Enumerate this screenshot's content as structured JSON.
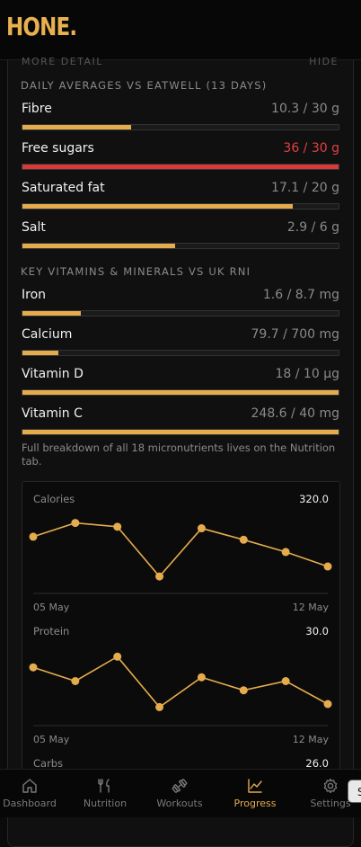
{
  "app": {
    "logo": "HONE."
  },
  "peek": {
    "left": "MORE DETAIL",
    "right": "HIDE"
  },
  "averages": {
    "title": "DAILY AVERAGES VS EATWELL (13 DAYS)",
    "items": [
      {
        "name": "Fibre",
        "value": "10.3 / 30 g",
        "fraction": 0.343,
        "over": false
      },
      {
        "name": "Free sugars",
        "value": "36 / 30 g",
        "fraction": 1.0,
        "over": true
      },
      {
        "name": "Saturated fat",
        "value": "17.1 / 20 g",
        "fraction": 0.855,
        "over": false
      },
      {
        "name": "Salt",
        "value": "2.9 / 6 g",
        "fraction": 0.483,
        "over": false
      }
    ]
  },
  "vitamins": {
    "title": "KEY VITAMINS & MINERALS VS UK RNI",
    "items": [
      {
        "name": "Iron",
        "value": "1.6 / 8.7 mg",
        "fraction": 0.184,
        "over": false
      },
      {
        "name": "Calcium",
        "value": "79.7 / 700 mg",
        "fraction": 0.114,
        "over": false
      },
      {
        "name": "Vitamin D",
        "value": "18 / 10 µg",
        "fraction": 1.0,
        "over": false
      },
      {
        "name": "Vitamin C",
        "value": "248.6 / 40 mg",
        "fraction": 1.0,
        "over": false
      }
    ]
  },
  "note": "Full breakdown of all 18 micronutrients lives on the Nutrition tab.",
  "trends": [
    {
      "label": "Calories",
      "max": "320.0",
      "start": "05 May",
      "end": "12 May",
      "normalized": [
        0.66,
        0.84,
        0.79,
        0.14,
        0.77,
        0.62,
        0.46,
        0.27
      ]
    },
    {
      "label": "Protein",
      "max": "30.0",
      "start": "05 May",
      "end": "12 May",
      "normalized": [
        0.68,
        0.5,
        0.82,
        0.16,
        0.55,
        0.38,
        0.5,
        0.2
      ]
    },
    {
      "label": "Carbs",
      "max": "26.0"
    }
  ],
  "nav": [
    {
      "label": "Dashboard",
      "icon": "home-icon",
      "active": false
    },
    {
      "label": "Nutrition",
      "icon": "fork-knife-icon",
      "active": false
    },
    {
      "label": "Workouts",
      "icon": "dumbbell-icon",
      "active": false
    },
    {
      "label": "Progress",
      "icon": "chart-icon",
      "active": true
    },
    {
      "label": "Settings",
      "icon": "gear-icon",
      "active": false
    }
  ],
  "toast": {
    "text": "S"
  },
  "colors": {
    "accent": "#e5ac4d",
    "over": "#d83a3a",
    "background": "#0b0b0b"
  }
}
